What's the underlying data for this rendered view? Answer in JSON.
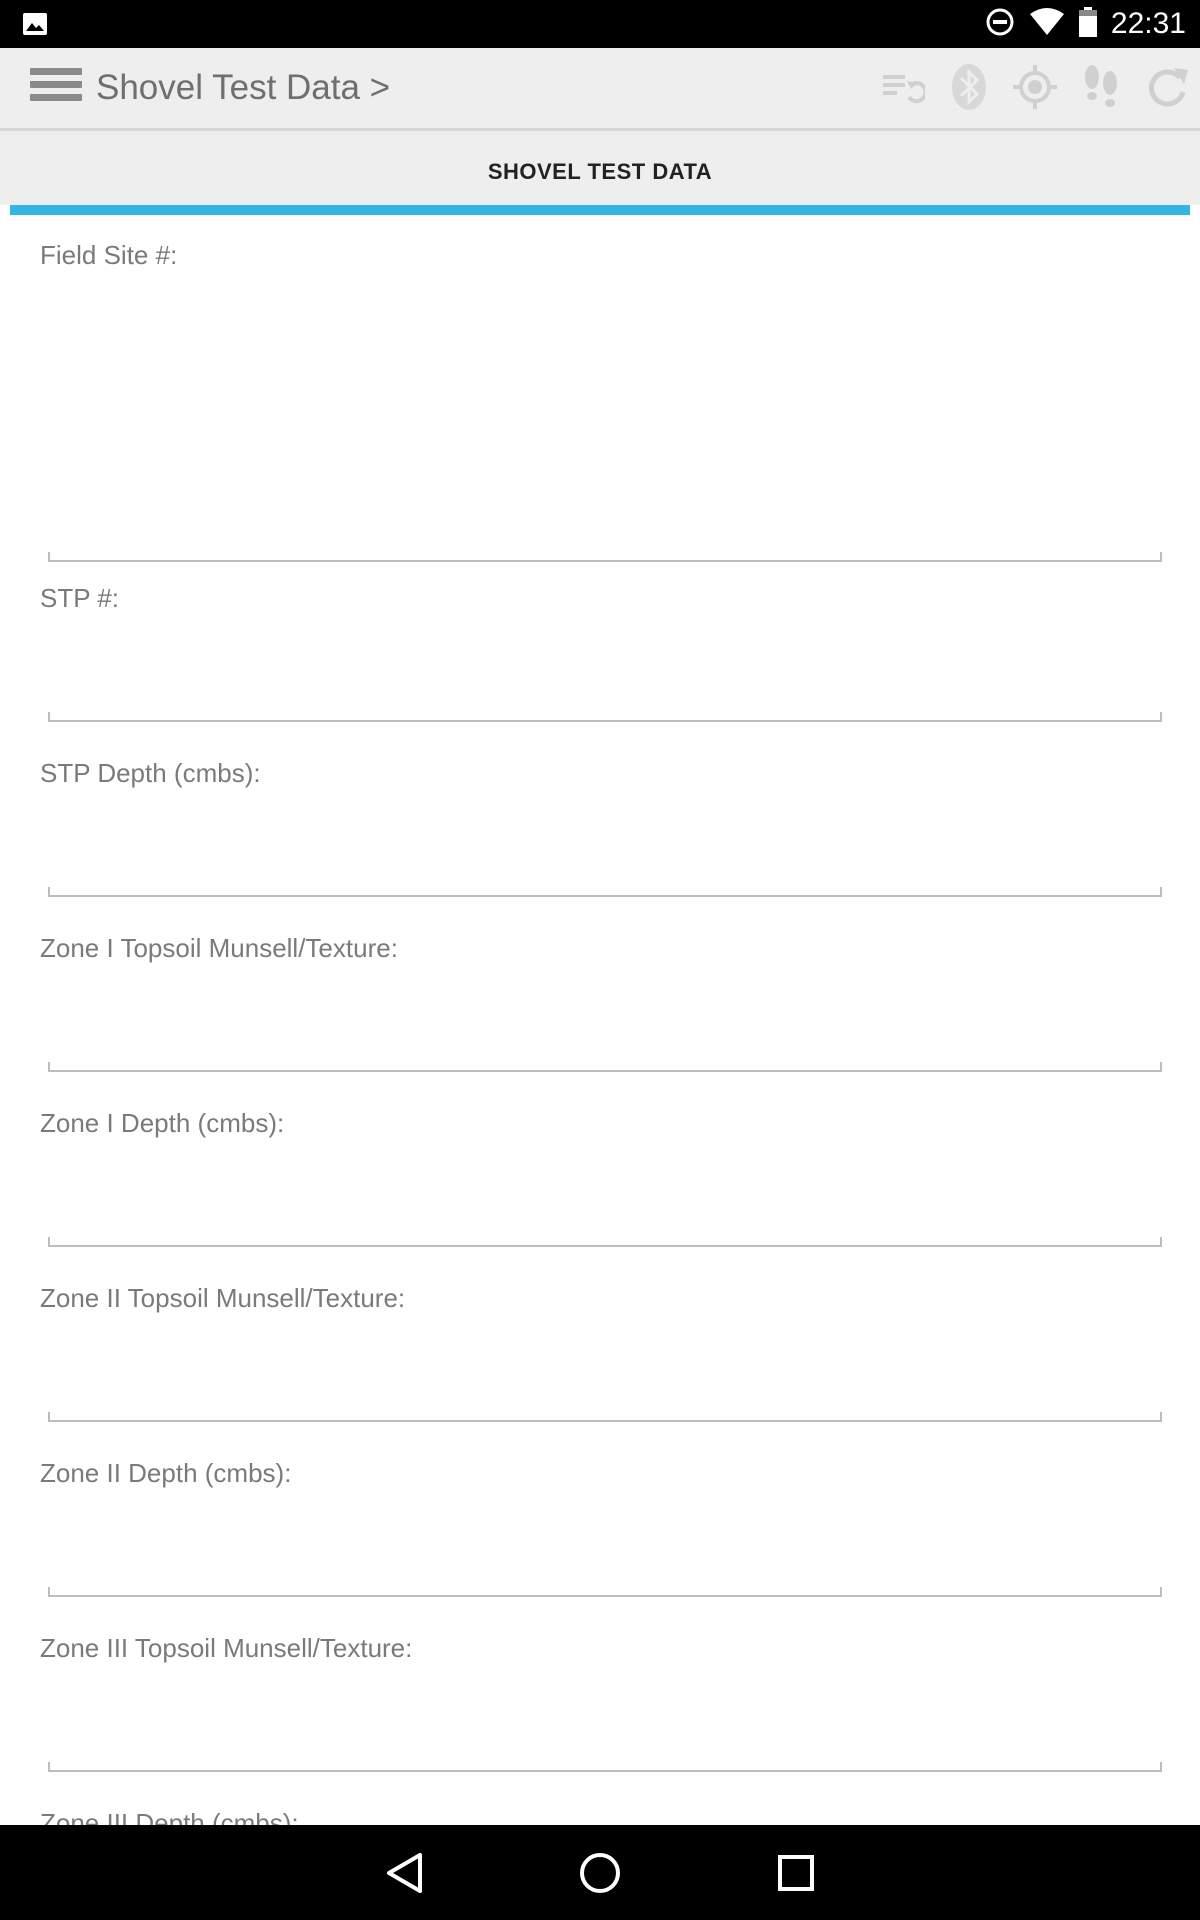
{
  "status_bar": {
    "time": "22:31",
    "icons": [
      "image-notification-icon",
      "do-not-disturb-icon",
      "wifi-icon",
      "battery-icon"
    ]
  },
  "toolbar": {
    "title": "Shovel Test Data >",
    "icons": [
      "sync-list-icon",
      "bluetooth-icon",
      "gps-location-icon",
      "footsteps-icon",
      "refresh-icon"
    ]
  },
  "section": {
    "title": "SHOVEL TEST DATA",
    "accent_color": "#33b5e5"
  },
  "form": {
    "fields": [
      {
        "label": "Field Site #:",
        "value": ""
      },
      {
        "label": "STP #:",
        "value": ""
      },
      {
        "label": "STP Depth (cmbs):",
        "value": ""
      },
      {
        "label": "Zone I Topsoil Munsell/Texture:",
        "value": ""
      },
      {
        "label": "Zone I Depth (cmbs):",
        "value": ""
      },
      {
        "label": "Zone II Topsoil Munsell/Texture:",
        "value": ""
      },
      {
        "label": "Zone II Depth (cmbs):",
        "value": ""
      },
      {
        "label": "Zone III Topsoil Munsell/Texture:",
        "value": ""
      },
      {
        "label": "Zone III Depth (cmbs):",
        "value": ""
      }
    ]
  },
  "navigation": {
    "buttons": [
      "back-icon",
      "home-icon",
      "recents-icon"
    ]
  }
}
